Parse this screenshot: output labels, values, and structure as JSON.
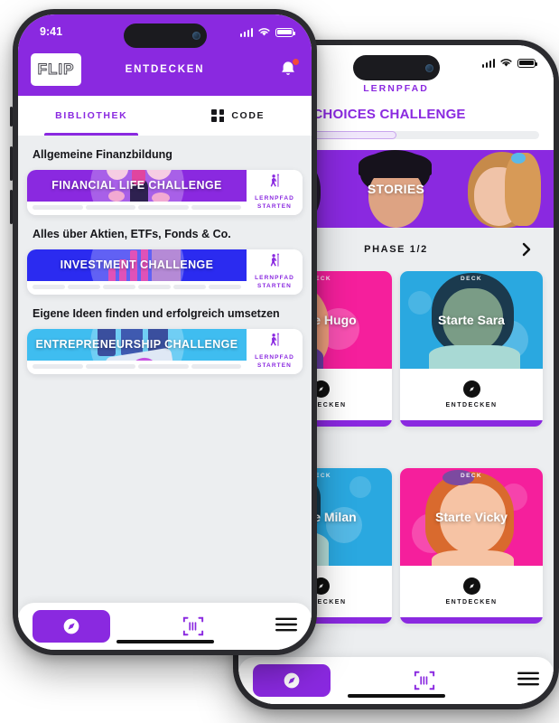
{
  "left_phone": {
    "status": {
      "time": "9:41",
      "signal_icon": "cellular-bars-icon",
      "wifi_icon": "wifi-icon",
      "battery_icon": "battery-icon"
    },
    "topbar": {
      "logo_text": "FLIP",
      "title": "ENTDECKEN",
      "bell_icon": "bell-icon",
      "has_notification": true,
      "bg": "#8a29e0"
    },
    "tabs": [
      {
        "label": "BIBLIOTHEK",
        "active": true,
        "icon": null
      },
      {
        "label": "CODE",
        "active": false,
        "icon": "qr-code-icon"
      }
    ],
    "sections": [
      {
        "title": "Allgemeine Finanzbildung",
        "card": {
          "name": "FINANCIAL LIFE CHALLENGE",
          "color": "#8a29e0",
          "side_label_1": "LERNPFAD",
          "side_label_2": "STARTEN",
          "side_icon": "hiker-icon",
          "progress_segments": 4
        }
      },
      {
        "title": "Alles über Aktien, ETFs, Fonds & Co.",
        "card": {
          "name": "INVESTMENT CHALLENGE",
          "color": "#2b2bf0",
          "side_label_1": "LERNPFAD",
          "side_label_2": "STARTEN",
          "side_icon": "hiker-icon",
          "progress_segments": 6
        }
      },
      {
        "title": "Eigene Ideen finden und erfolgreich umsetzen",
        "card": {
          "name": "ENTREPRENEURSHIP CHALLENGE",
          "color": "#3fbdf0",
          "side_label_1": "LERNPFAD",
          "side_label_2": "STARTEN",
          "side_icon": "hiker-icon",
          "progress_segments": 4
        }
      }
    ],
    "bottom_nav": [
      {
        "icon": "compass-icon",
        "active": true
      },
      {
        "icon": "barcode-scan-icon",
        "active": false
      },
      {
        "icon": "hamburger-menu-icon",
        "active": false
      }
    ]
  },
  "right_phone": {
    "status": {
      "signal_icon": "cellular-bars-icon",
      "wifi_icon": "wifi-icon",
      "battery_icon": "battery-icon"
    },
    "header": {
      "kicker": "LERNPFAD",
      "title": "FUTURE CHOICES CHALLENGE",
      "progress_percent": 50,
      "accent": "#8a29e0"
    },
    "stories_banner": {
      "label": "STORIES",
      "bg": "#8a29e0"
    },
    "phase": {
      "label": "PHASE 1/2",
      "next_icon": "chevron-right-icon"
    },
    "decks": [
      {
        "tag": "DECK",
        "name": "Starte Hugo",
        "cta": "ENTDECKEN",
        "badge_icon": "compass-icon",
        "bg": "#f51f9c"
      },
      {
        "tag": "DECK",
        "name": "Starte Sara",
        "cta": "ENTDECKEN",
        "badge_icon": "compass-icon",
        "bg": "#2aa8e0"
      },
      {
        "tag": "DECK",
        "name": "Starte Milan",
        "cta": "ENTDECKEN",
        "badge_icon": "compass-icon",
        "bg": "#2aa8e0"
      },
      {
        "tag": "DECK",
        "name": "Starte Vicky",
        "cta": "ENTDECKEN",
        "badge_icon": "compass-icon",
        "bg": "#f51f9c"
      }
    ],
    "bottom_nav": [
      {
        "icon": "compass-icon",
        "active": true
      },
      {
        "icon": "barcode-scan-icon",
        "active": false
      },
      {
        "icon": "hamburger-menu-icon",
        "active": false
      }
    ]
  }
}
